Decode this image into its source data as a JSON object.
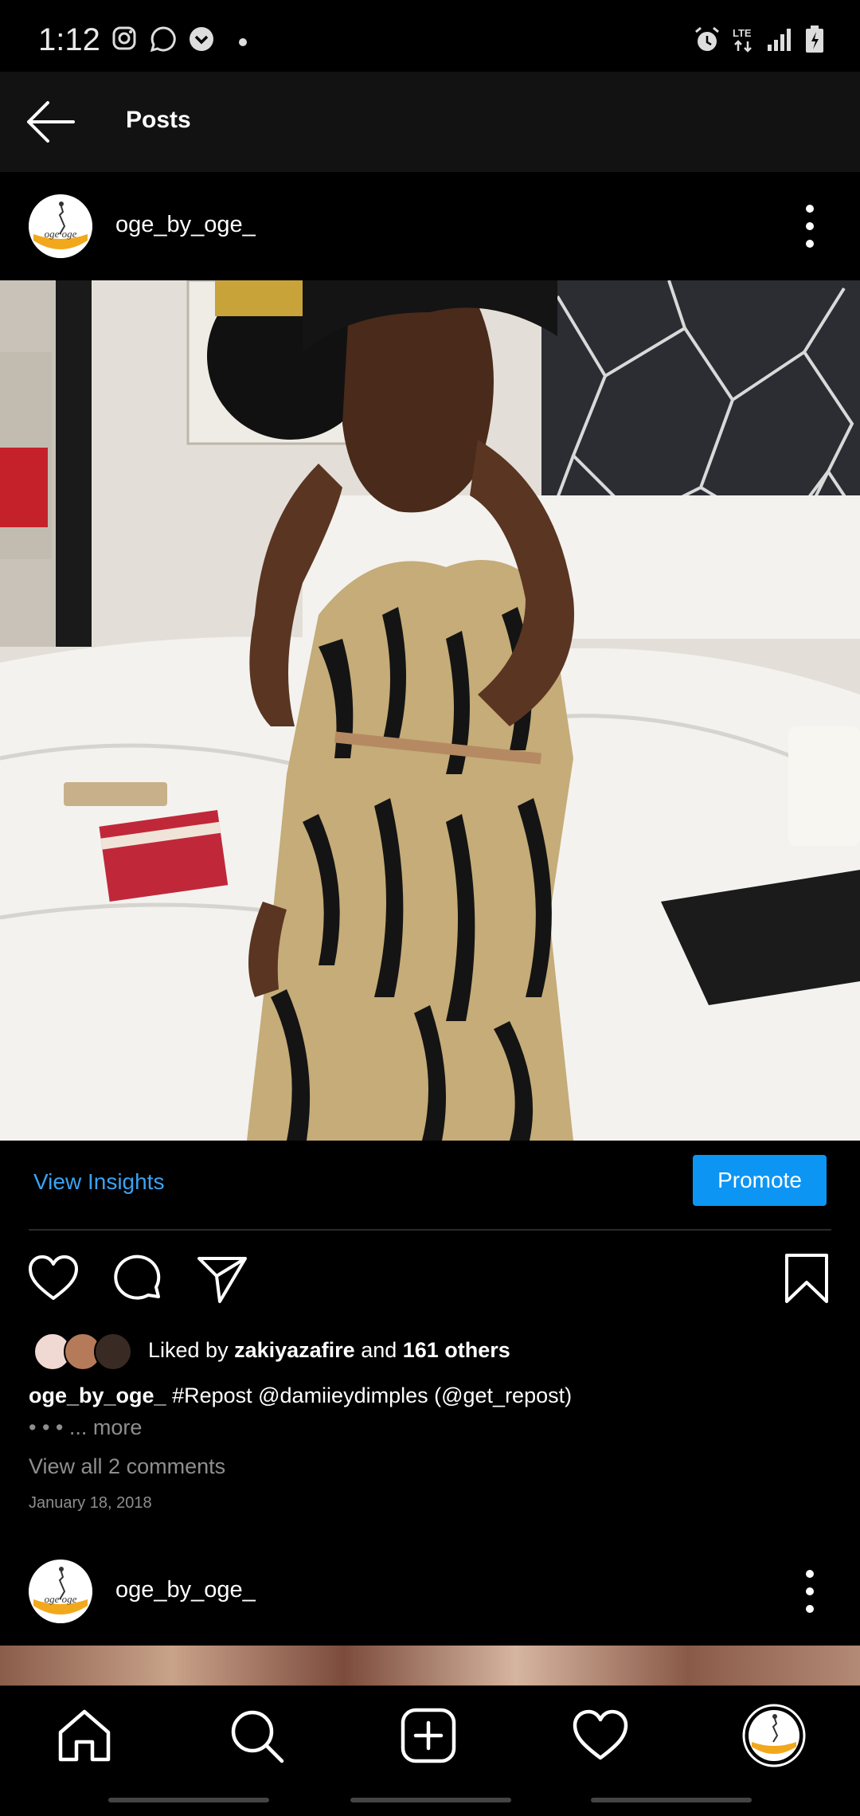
{
  "status_bar": {
    "time": "1:12",
    "icons": [
      "instagram-icon",
      "whatsapp-icon",
      "notification-icon",
      "alarm-icon",
      "lte-icon",
      "signal-icon",
      "battery-icon"
    ],
    "network": "LTE"
  },
  "header": {
    "title": "Posts",
    "back_icon": "back-arrow-icon"
  },
  "post": {
    "username": "oge_by_oge_",
    "avatar_text": "oge·oge",
    "view_insights": "View Insights",
    "promote": "Promote",
    "likes_prefix": "Liked by ",
    "likes_user": "zakiyazafire",
    "likes_mid": " and ",
    "likes_others": "161 others",
    "caption_user": "oge_by_oge_",
    "caption_text": " #Repost @damiieydimples (@get_repost)",
    "caption_dots": "• • • ",
    "caption_more": "... more",
    "view_comments": "View all 2 comments",
    "date": "January 18, 2018"
  },
  "next_post": {
    "username": "oge_by_oge_"
  },
  "bottom_nav": {
    "items": [
      "home-icon",
      "search-icon",
      "add-post-icon",
      "activity-heart-icon",
      "profile-avatar-icon"
    ]
  },
  "colors": {
    "accent_blue": "#0d95f4",
    "link_blue": "#3aa3f2",
    "secondary_text": "#8e8e8e",
    "header_bg": "#121212"
  }
}
